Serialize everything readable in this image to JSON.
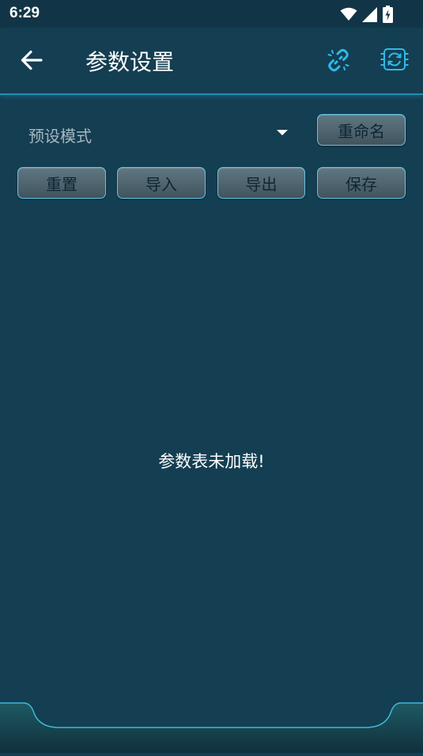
{
  "status_bar": {
    "time": "6:29"
  },
  "header": {
    "title": "参数设置",
    "back_icon": "arrow-left-icon",
    "link_icon": "link-broken-icon",
    "sync_icon": "sync-chip-icon",
    "accent_color": "#2ebae6"
  },
  "controls": {
    "preset_label": "预设模式",
    "rename_label": "重命名",
    "reset_label": "重置",
    "import_label": "导入",
    "export_label": "导出",
    "save_label": "保存"
  },
  "content": {
    "empty_message": "参数表未加载!"
  },
  "colors": {
    "background": "#143e52",
    "button_border": "#5fc6e6",
    "button_text": "#0e2633"
  }
}
